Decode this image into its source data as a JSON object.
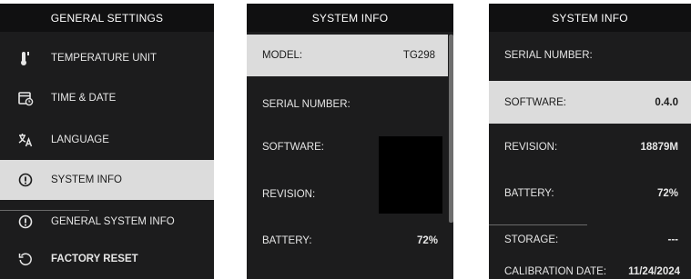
{
  "screen1": {
    "title": "GENERAL SETTINGS",
    "items": [
      {
        "label": "TEMPERATURE UNIT",
        "icon": "thermometer-icon"
      },
      {
        "label": "TIME & DATE",
        "icon": "calendar-clock-icon"
      },
      {
        "label": "LANGUAGE",
        "icon": "translate-icon"
      },
      {
        "label": "SYSTEM INFO",
        "icon": "info-icon",
        "selected": true
      },
      {
        "label": "GENERAL SYSTEM INFO",
        "icon": "info-icon"
      },
      {
        "label": "FACTORY RESET",
        "icon": "reset-icon"
      }
    ]
  },
  "screen2": {
    "title": "SYSTEM INFO",
    "rows": [
      {
        "key": "MODEL:",
        "value": "TG298",
        "selected": true
      },
      {
        "key": "SERIAL NUMBER:",
        "value": ""
      },
      {
        "key": "SOFTWARE:",
        "value": ""
      },
      {
        "key": "REVISION:",
        "value": ""
      },
      {
        "key": "BATTERY:",
        "value": "72%"
      }
    ]
  },
  "screen3": {
    "title": "SYSTEM INFO",
    "rows": [
      {
        "key": "SERIAL NUMBER:",
        "value": ""
      },
      {
        "key": "SOFTWARE:",
        "value": "0.4.0",
        "selected": true
      },
      {
        "key": "REVISION:",
        "value": "18879M"
      },
      {
        "key": "BATTERY:",
        "value": "72%"
      },
      {
        "key": "STORAGE:",
        "value": "---"
      },
      {
        "key": "CALIBRATION DATE:",
        "value": "11/24/2024"
      }
    ]
  },
  "colors": {
    "screen_bg": "#1c1c1d",
    "title_bg": "#101011",
    "highlight_bg": "#dcdcdc",
    "text": "#e6e6e6"
  }
}
